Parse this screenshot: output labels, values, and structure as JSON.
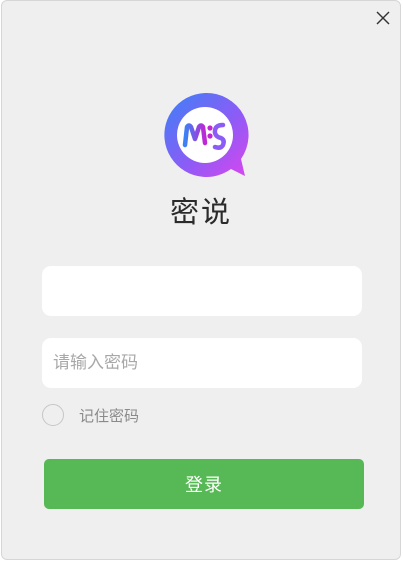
{
  "app": {
    "name": "密说",
    "logo_text": "ms"
  },
  "form": {
    "username": {
      "value": "",
      "placeholder": ""
    },
    "password": {
      "value": "",
      "placeholder": "请输入密码"
    },
    "remember_label": "记住密码",
    "remember_checked": false,
    "login_label": "登录"
  },
  "icons": {
    "close": "close-icon",
    "logo": "chat-bubble-logo-icon"
  },
  "colors": {
    "background": "#efefef",
    "primary_button": "#57b955",
    "logo_gradient_start": "#3b82f6",
    "logo_gradient_end": "#c026d3"
  }
}
